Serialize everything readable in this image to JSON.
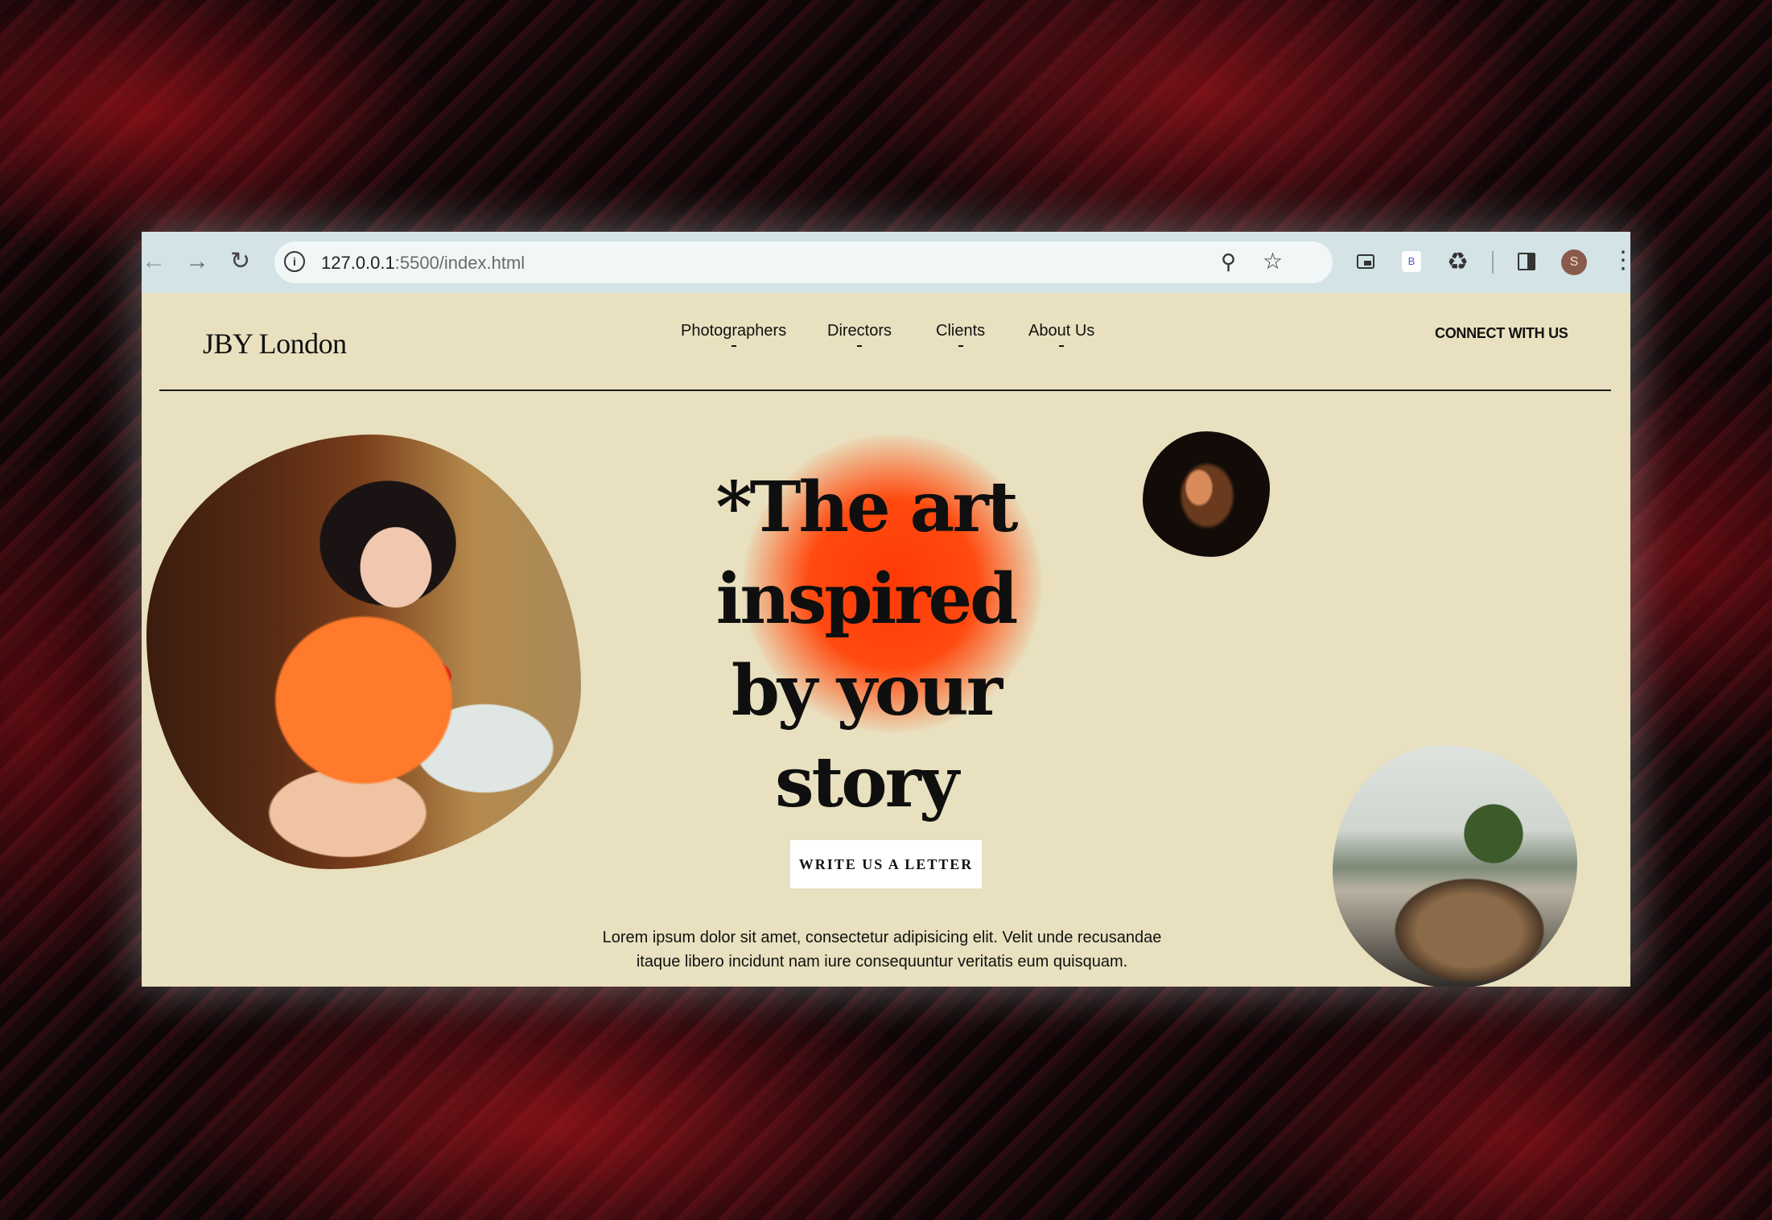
{
  "browser": {
    "url_host": "127.0.0.1",
    "url_rest": ":5500/index.html",
    "extension_badge": "B",
    "profile_initial": "S",
    "icons": [
      "back-arrow-icon",
      "forward-arrow-icon",
      "reload-icon",
      "site-info-icon",
      "zoom-icon",
      "star-icon",
      "picture-in-picture-icon",
      "extensions-icon",
      "side-panel-icon",
      "menu-dots-icon"
    ]
  },
  "header": {
    "logo": "JBY London",
    "nav": [
      "Photographers",
      "Directors",
      "Clients",
      "About Us"
    ],
    "connect": "CONNECT WITH US"
  },
  "hero": {
    "headline_lines": [
      "*The art",
      "inspired",
      "by your",
      "story"
    ],
    "cta": "WRITE US A LETTER",
    "description_line1": "Lorem ipsum dolor sit amet, consectetur adipisicing elit. Velit unde recusandae",
    "description_line2": "itaque libero incidunt nam iure consequuntur veritatis eum quisquam."
  },
  "colors": {
    "page_bg": "#e8e0bf",
    "glow": "#ff3a06",
    "chrome_bg": "#d3e3e6",
    "text": "#0f0f0f"
  }
}
